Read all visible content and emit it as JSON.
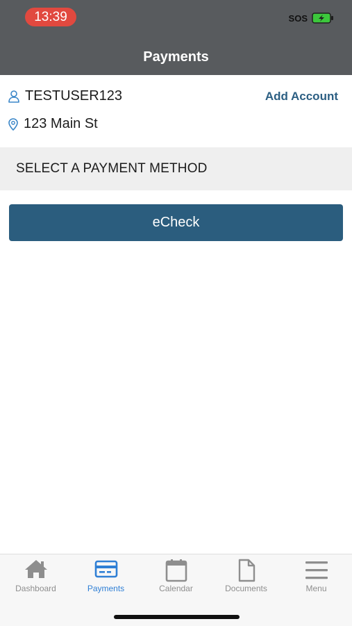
{
  "status_bar": {
    "time": "13:39",
    "sos": "SOS"
  },
  "header": {
    "title": "Payments"
  },
  "account": {
    "name": "TESTUSER123",
    "address": "123 Main St",
    "add_account_label": "Add Account"
  },
  "section": {
    "title": "SELECT A PAYMENT METHOD"
  },
  "payment_methods": [
    {
      "label": "eCheck"
    }
  ],
  "tabs": [
    {
      "label": "Dashboard",
      "icon": "house-icon",
      "active": false
    },
    {
      "label": "Payments",
      "icon": "credit-card-icon",
      "active": true
    },
    {
      "label": "Calendar",
      "icon": "calendar-icon",
      "active": false
    },
    {
      "label": "Documents",
      "icon": "document-icon",
      "active": false
    },
    {
      "label": "Menu",
      "icon": "menu-icon",
      "active": false
    }
  ],
  "colors": {
    "header_bg": "#585b5e",
    "accent": "#2b5d7e",
    "link": "#2c5f83",
    "active_tab": "#2f7fd5",
    "inactive_tab": "#8e8e8e",
    "time_pill": "#e1493f",
    "battery": "#3cc83c"
  }
}
